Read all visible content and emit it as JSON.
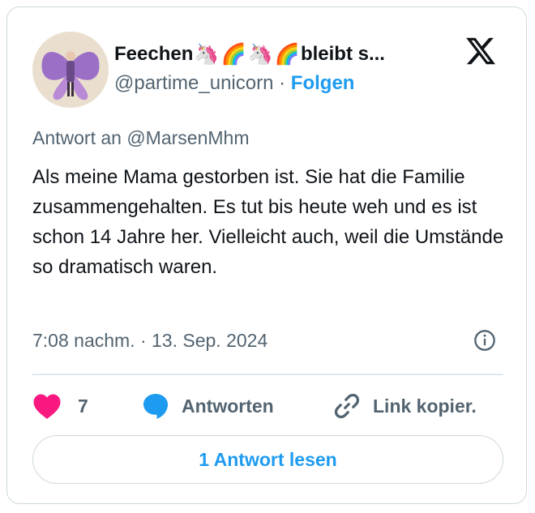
{
  "author": {
    "name": "Feechen",
    "name_suffix": "bleibt s...",
    "emojis": [
      "🦄",
      "🌈",
      "🦄",
      "🌈"
    ],
    "handle": "@partime_unicorn",
    "separator": "·",
    "follow_label": "Folgen"
  },
  "tweet": {
    "reply_to": "Antwort an @MarsenMhm",
    "text": "Als meine Mama gestorben ist. Sie hat die Familie zusammengehalten. Es tut bis heute weh und es ist schon 14 Jahre her. Vielleicht auch, weil die Umstände so dramatisch waren.",
    "timestamp": "7:08 nachm. · 13. Sep. 2024"
  },
  "actions": {
    "like_count": "7",
    "reply_label": "Antworten",
    "copy_link_label": "Link kopier."
  },
  "read_replies_label": "1 Antwort lesen",
  "icons": [
    "x-logo-icon",
    "heart-icon",
    "speech-bubble-icon",
    "link-icon",
    "info-icon"
  ],
  "colors": {
    "accent": "#1d9bf0",
    "like": "#f91880",
    "text_secondary": "#536471",
    "border": "#cfd9de"
  }
}
